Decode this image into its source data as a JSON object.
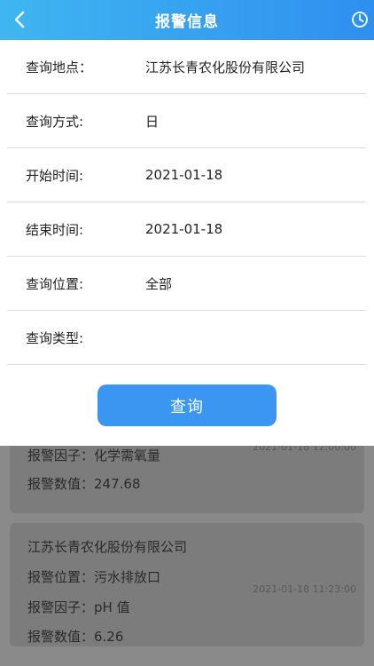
{
  "header": {
    "title": "报警信息"
  },
  "form": {
    "rows": [
      {
        "label": "查询地点：",
        "value": "江苏长青农化股份有限公司"
      },
      {
        "label": "查询方式:",
        "value": "日"
      },
      {
        "label": "开始时间:",
        "value": "2021-01-18"
      },
      {
        "label": "结束时间:",
        "value": "2021-01-18"
      },
      {
        "label": "查询位置:",
        "value": "全部"
      },
      {
        "label": "查询类型:",
        "value": ""
      }
    ],
    "submit_label": "查询"
  },
  "list": {
    "cards": [
      {
        "time": "2021-01-18 12:00:00",
        "factor": "报警因子：化学需氧量",
        "value": "报警数值：247.68"
      },
      {
        "company": "江苏长青农化股份有限公司",
        "position": "报警位置：污水排放口",
        "factor": "报警因子：pH 值",
        "value": "报警数值：6.26",
        "time": "2021-01-18 11:23:00"
      }
    ]
  }
}
